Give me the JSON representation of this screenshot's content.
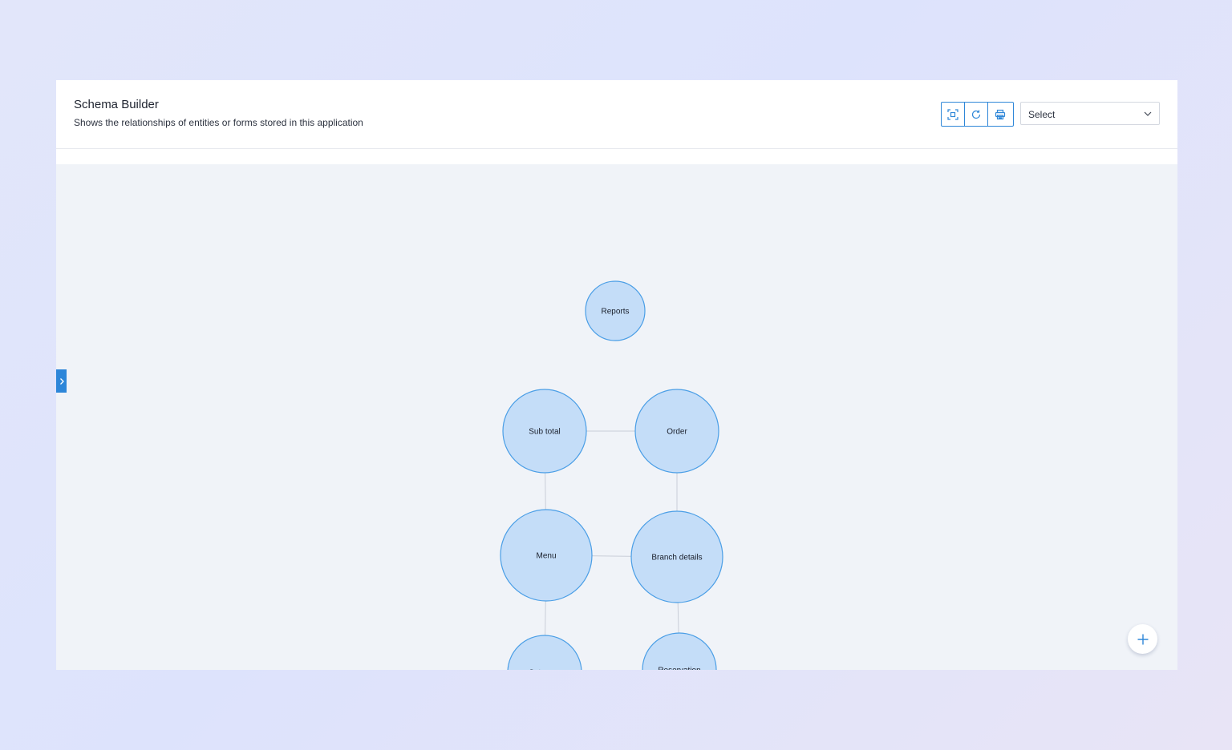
{
  "header": {
    "title": "Schema Builder",
    "subtitle": "Shows the relationships of entities or forms stored in this application"
  },
  "toolbar": {
    "buttons": [
      {
        "icon": "fit-to-screen-icon"
      },
      {
        "icon": "refresh-icon"
      },
      {
        "icon": "print-icon"
      }
    ]
  },
  "select": {
    "value": "Select",
    "icon": "chevron-down-icon"
  },
  "graph": {
    "nodes": [
      {
        "id": "reports",
        "label": "Reports"
      },
      {
        "id": "subtotal",
        "label": "Sub total"
      },
      {
        "id": "order",
        "label": "Order"
      },
      {
        "id": "menu",
        "label": "Menu"
      },
      {
        "id": "branch",
        "label": "Branch details"
      },
      {
        "id": "category",
        "label": "Category"
      },
      {
        "id": "reservation",
        "label": "Reservation"
      }
    ],
    "edges": [
      [
        "subtotal",
        "order"
      ],
      [
        "subtotal",
        "menu"
      ],
      [
        "order",
        "branch"
      ],
      [
        "menu",
        "branch"
      ],
      [
        "menu",
        "category"
      ],
      [
        "branch",
        "reservation"
      ]
    ]
  },
  "colors": {
    "accent": "#2f87d8",
    "node_fill": "#c4ddf8",
    "node_stroke": "#4a9ee6",
    "edge": "#c9ced8",
    "canvas_bg": "#f0f3f8"
  },
  "side_toggle": {
    "icon": "chevron-right-icon"
  },
  "fab": {
    "icon": "plus-icon"
  }
}
